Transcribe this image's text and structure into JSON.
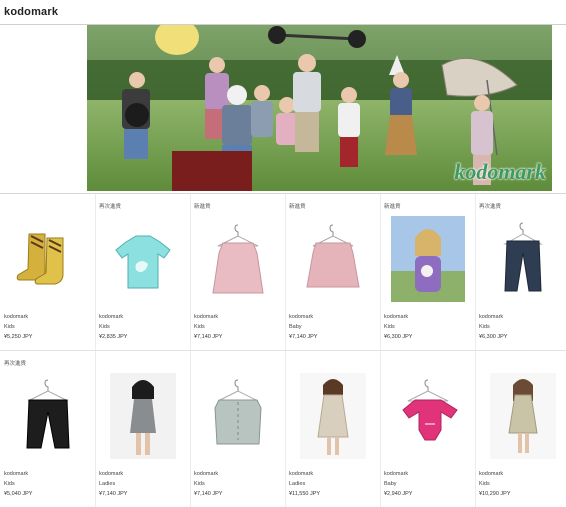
{
  "site": {
    "title": "kodomark"
  },
  "hero": {
    "logo_text": "kodomark"
  },
  "products": [
    {
      "tag": "",
      "brand": "kodomark",
      "category": "Kids",
      "price": "¥5,250 JPY",
      "icon": "rain-boots"
    },
    {
      "tag": "再次進貨",
      "brand": "kodomark",
      "category": "Kids",
      "price": "¥2,835 JPY",
      "icon": "tshirt"
    },
    {
      "tag": "新進貨",
      "brand": "kodomark",
      "category": "Kids",
      "price": "¥7,140 JPY",
      "icon": "dress"
    },
    {
      "tag": "新進貨",
      "brand": "kodomark",
      "category": "Baby",
      "price": "¥7,140 JPY",
      "icon": "dress"
    },
    {
      "tag": "新進貨",
      "brand": "kodomark",
      "category": "Kids",
      "price": "¥6,300 JPY",
      "icon": "girl-photo"
    },
    {
      "tag": "再次進貨",
      "brand": "kodomark",
      "category": "Kids",
      "price": "¥6,300 JPY",
      "icon": "pants"
    },
    {
      "tag": "再次進貨",
      "brand": "kodomark",
      "category": "Kids",
      "price": "¥5,040 JPY",
      "icon": "pants-black"
    },
    {
      "tag": "",
      "brand": "kodomark",
      "category": "Ladies",
      "price": "¥7,140 JPY",
      "icon": "woman-photo"
    },
    {
      "tag": "",
      "brand": "kodomark",
      "category": "Kids",
      "price": "¥7,140 JPY",
      "icon": "top"
    },
    {
      "tag": "",
      "brand": "kodomark",
      "category": "Ladies",
      "price": "¥11,550 JPY",
      "icon": "woman-dress-photo"
    },
    {
      "tag": "",
      "brand": "kodomark",
      "category": "Baby",
      "price": "¥2,940 JPY",
      "icon": "onesie"
    },
    {
      "tag": "",
      "brand": "kodomark",
      "category": "Kids",
      "price": "¥10,290 JPY",
      "icon": "girl-dress-photo"
    }
  ]
}
